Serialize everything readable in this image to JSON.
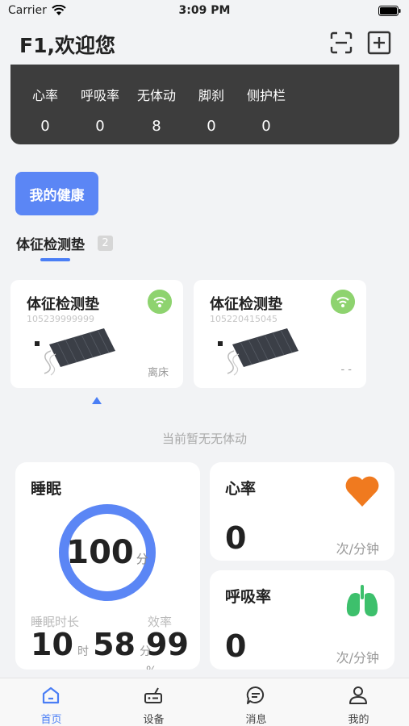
{
  "status_bar": {
    "carrier": "Carrier",
    "time": "3:09 PM"
  },
  "header": {
    "title": "F1,欢迎您",
    "scan_icon": "scan-icon",
    "add_icon": "add-icon"
  },
  "stats": [
    {
      "label": "心率",
      "value": "0"
    },
    {
      "label": "呼吸率",
      "value": "0"
    },
    {
      "label": "无体动",
      "value": "8"
    },
    {
      "label": "脚刹",
      "value": "0"
    },
    {
      "label": "侧护栏",
      "value": "0"
    }
  ],
  "health_button": "我的健康",
  "device_tab": {
    "label": "体征检测垫",
    "count": "2"
  },
  "devices": [
    {
      "name": "体征检测垫",
      "serial": "105239999999",
      "status": "离床"
    },
    {
      "name": "体征检测垫",
      "serial": "105220415045",
      "status": "- -"
    }
  ],
  "no_movement_text": "当前暂无无体动",
  "sleep": {
    "title": "睡眠",
    "score": "100",
    "score_unit": "分",
    "score_fraction": 1.0,
    "duration_label": "睡眠时长",
    "duration_hours": "10",
    "hours_unit": "时",
    "duration_minutes": "58",
    "minutes_unit": "分",
    "efficiency_label": "效率",
    "efficiency": "99",
    "efficiency_unit": "%"
  },
  "heart_rate": {
    "title": "心率",
    "value": "0",
    "unit": "次/分钟",
    "icon": "heart-icon"
  },
  "resp_rate": {
    "title": "呼吸率",
    "value": "0",
    "unit": "次/分钟",
    "icon": "lungs-icon"
  },
  "tabs": [
    {
      "label": "首页",
      "icon": "home-icon",
      "active": true
    },
    {
      "label": "设备",
      "icon": "device-icon",
      "active": false
    },
    {
      "label": "消息",
      "icon": "message-icon",
      "active": false
    },
    {
      "label": "我的",
      "icon": "user-icon",
      "active": false
    }
  ],
  "colors": {
    "accent": "#4a7ef5",
    "wifi_green": "#8ed36f",
    "heart": "#f07a1f",
    "lungs": "#3dc06c",
    "panel": "#3d3d3d"
  }
}
